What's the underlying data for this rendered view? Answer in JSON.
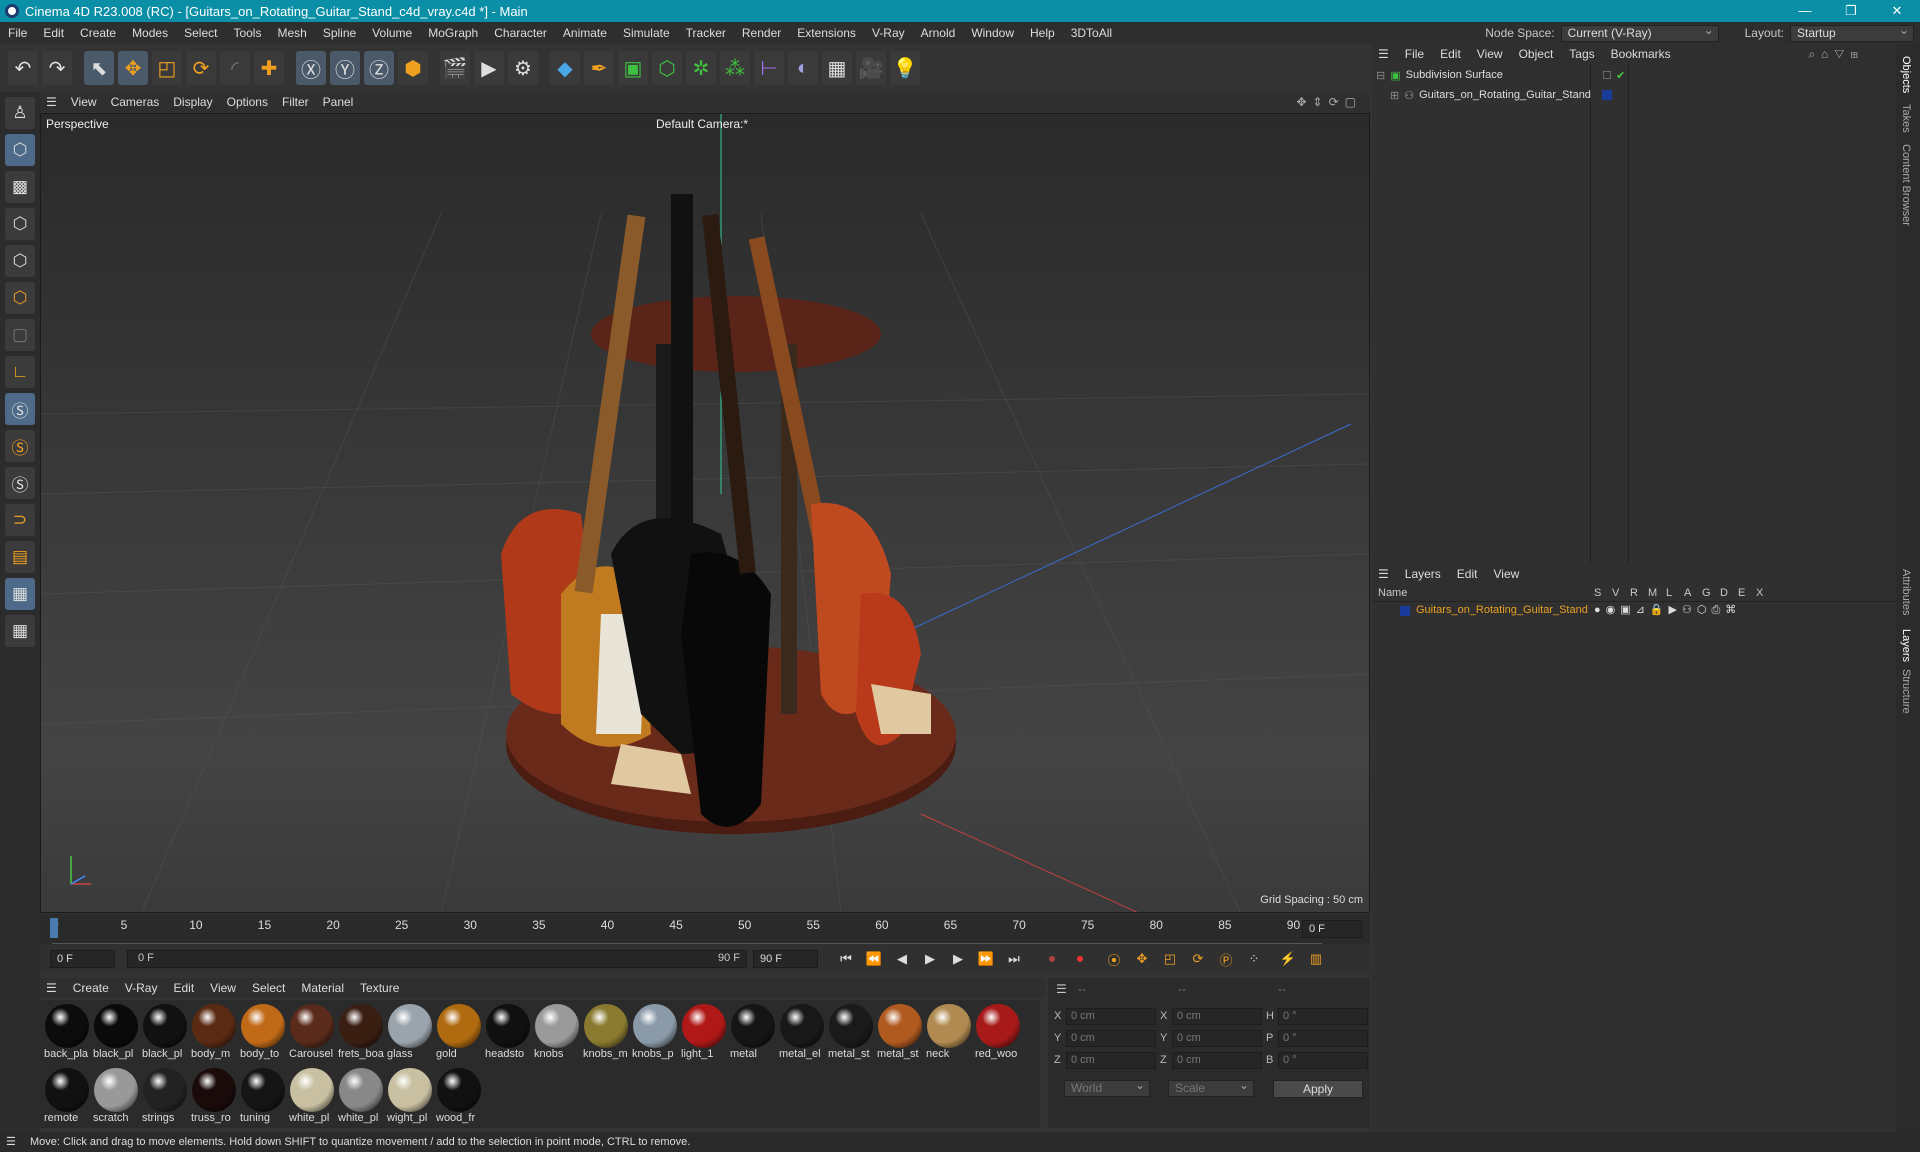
{
  "title": "Cinema 4D R23.008 (RC) - [Guitars_on_Rotating_Guitar_Stand_c4d_vray.c4d *] - Main",
  "window_controls": [
    "—",
    "❐",
    "✕"
  ],
  "menu": [
    "File",
    "Edit",
    "Create",
    "Modes",
    "Select",
    "Tools",
    "Mesh",
    "Spline",
    "Volume",
    "MoGraph",
    "Character",
    "Animate",
    "Simulate",
    "Tracker",
    "Render",
    "Extensions",
    "V-Ray",
    "Arnold",
    "Window",
    "Help",
    "3DToAll"
  ],
  "node_space": {
    "label": "Node Space:",
    "value": "Current (V-Ray)"
  },
  "layout": {
    "label": "Layout:",
    "value": "Startup"
  },
  "viewport": {
    "menu": [
      "View",
      "Cameras",
      "Display",
      "Options",
      "Filter",
      "Panel"
    ],
    "label": "Perspective",
    "camera": "Default Camera:*",
    "grid_spacing": "Grid Spacing : 50 cm"
  },
  "timeline": {
    "ticks": [
      "0",
      "5",
      "10",
      "15",
      "20",
      "25",
      "30",
      "35",
      "40",
      "45",
      "50",
      "55",
      "60",
      "65",
      "70",
      "75",
      "80",
      "85",
      "90"
    ],
    "current_frame": "0 F"
  },
  "playback": {
    "start": "0 F",
    "range_start": "0 F",
    "range_end": "90 F",
    "end": "90 F"
  },
  "material_menu": [
    "Create",
    "V-Ray",
    "Edit",
    "View",
    "Select",
    "Material",
    "Texture"
  ],
  "materials": [
    {
      "name": "back_pla",
      "color": "#0c0c0c"
    },
    {
      "name": "black_pl",
      "color": "#0a0a0a"
    },
    {
      "name": "black_pl",
      "color": "#111"
    },
    {
      "name": "body_m",
      "color": "#5a2a12"
    },
    {
      "name": "body_to",
      "color": "#c06a18"
    },
    {
      "name": "Carousel",
      "color": "#5a2a1a"
    },
    {
      "name": "frets_boa",
      "color": "#3a1e12"
    },
    {
      "name": "glass",
      "color": "#9aa4ac"
    },
    {
      "name": "gold",
      "color": "#b06a10"
    },
    {
      "name": "headsto",
      "color": "#101010"
    },
    {
      "name": "knobs",
      "color": "#9a9a9a"
    },
    {
      "name": "knobs_m",
      "color": "#8a7a30"
    },
    {
      "name": "knobs_p",
      "color": "#8a9aa8"
    },
    {
      "name": "light_1",
      "color": "#b01818"
    },
    {
      "name": "metal",
      "color": "#151515"
    },
    {
      "name": "metal_el",
      "color": "#181818"
    },
    {
      "name": "metal_st",
      "color": "#1a1a1a"
    },
    {
      "name": "metal_st",
      "color": "#b05a20"
    },
    {
      "name": "neck",
      "color": "#b08a50"
    },
    {
      "name": "red_woo",
      "color": "#a81a1a"
    },
    {
      "name": "remote",
      "color": "#111"
    },
    {
      "name": "scratch",
      "color": "#999"
    },
    {
      "name": "strings",
      "color": "#222"
    },
    {
      "name": "truss_ro",
      "color": "#1a0a0a"
    },
    {
      "name": "tuning",
      "color": "#151515"
    },
    {
      "name": "white_pl",
      "color": "#c8c0a0"
    },
    {
      "name": "white_pl",
      "color": "#888"
    },
    {
      "name": "wight_pl",
      "color": "#c8c0a0"
    },
    {
      "name": "wood_fr",
      "color": "#111"
    }
  ],
  "coords": {
    "header": [
      "--",
      "--",
      "--"
    ],
    "rows": [
      {
        "a": "X",
        "av": "0 cm",
        "b": "X",
        "bv": "0 cm",
        "c": "H",
        "cv": "0 °"
      },
      {
        "a": "Y",
        "av": "0 cm",
        "b": "Y",
        "bv": "0 cm",
        "c": "P",
        "cv": "0 °"
      },
      {
        "a": "Z",
        "av": "0 cm",
        "b": "Z",
        "bv": "0 cm",
        "c": "B",
        "cv": "0 °"
      }
    ],
    "space": "World",
    "mode": "Scale",
    "apply": "Apply"
  },
  "objects_menu": [
    "File",
    "Edit",
    "View",
    "Object",
    "Tags",
    "Bookmarks"
  ],
  "objects": [
    "Subdivision Surface",
    "Guitars_on_Rotating_Guitar_Stand"
  ],
  "layers_menu": [
    "Layers",
    "Edit",
    "View"
  ],
  "layers_header": {
    "name": "Name",
    "flags": [
      "S",
      "V",
      "R",
      "M",
      "L",
      "A",
      "G",
      "D",
      "E",
      "X"
    ]
  },
  "layers": [
    "Guitars_on_Rotating_Guitar_Stand"
  ],
  "side_tabs": [
    "Objects",
    "Takes",
    "Content Browser",
    "Attributes",
    "Layers",
    "Structure"
  ],
  "status": "Move: Click and drag to move elements. Hold down SHIFT to quantize movement / add to the selection in point mode, CTRL to remove.",
  "colors": {
    "titlebar": "#0b8fa6",
    "layer_name": "#e8a020",
    "accent": "#4d6b88"
  }
}
